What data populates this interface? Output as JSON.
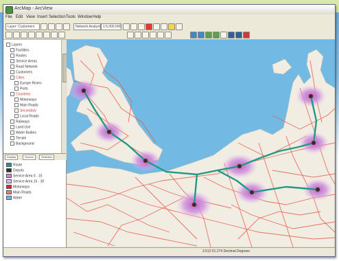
{
  "app": {
    "title": "ArcMap - ArcView"
  },
  "menu": [
    "File",
    "Edit",
    "View",
    "Insert",
    "Selection",
    "Tools",
    "Window",
    "Help"
  ],
  "toolbar": {
    "layer_dropdown": "Layer: Customers",
    "target_dropdown": "Network Analyst",
    "scale_dropdown": "1:5,000,000"
  },
  "toc": {
    "layers": [
      "Layers",
      "Facilities",
      "Routes",
      "Service Areas",
      "Road Network",
      "Customers",
      "Cities",
      "Europe Rivers",
      "Ports",
      "Countries",
      "Motorways",
      "Main Roads",
      "Secondary",
      "Local Roads",
      "Railways",
      "Land Use",
      "Water Bodies",
      "Terrain",
      "Background"
    ],
    "tabs": [
      "Display",
      "Source",
      "Selection"
    ]
  },
  "legend": {
    "items": [
      {
        "label": "Route",
        "color": "#1f9a86"
      },
      {
        "label": "Depots",
        "color": "#2f2f2f"
      },
      {
        "label": "Service Area 0 - 15",
        "color": "#c98bd6"
      },
      {
        "label": "Service Area 15 - 30",
        "color": "#e2b8ea"
      },
      {
        "label": "Motorways",
        "color": "#d92b2b"
      },
      {
        "label": "Main Roads",
        "color": "#f07c6c"
      },
      {
        "label": "Water",
        "color": "#72b9e4"
      }
    ]
  },
  "status": {
    "coordinates": "3.512  51.274 Decimal Degrees"
  },
  "colors": {
    "sea": "#72b9e4",
    "land": "#f1ede3",
    "route": "#1f9a86",
    "roads": "#e45a4a",
    "service_area": "#c98bd6"
  }
}
